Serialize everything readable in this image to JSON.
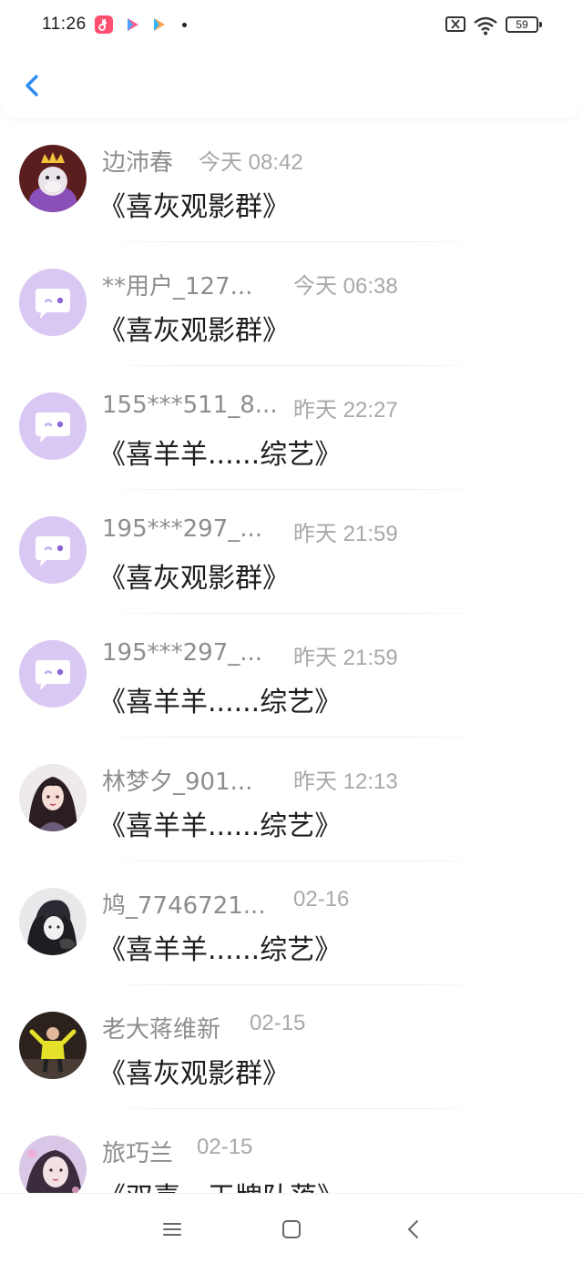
{
  "status_bar": {
    "time": "11:26",
    "battery": "59",
    "app_icons": [
      "douyin-icon",
      "play-icon",
      "play-icon"
    ]
  },
  "header": {
    "back_icon": "chevron-left-icon",
    "accent_color": "#2a8cf0"
  },
  "messages": [
    {
      "name": "边沛春",
      "time": "今天 08:42",
      "message": "《喜灰观影群》",
      "avatar": "cartoon-king-avatar"
    },
    {
      "name": "**用户_127...",
      "time": "今天 06:38",
      "message": "《喜灰观影群》",
      "avatar": "default-chat-avatar"
    },
    {
      "name": "155***511_8...",
      "time": "昨天 22:27",
      "message": "《喜羊羊......综艺》",
      "avatar": "default-chat-avatar"
    },
    {
      "name": "195***297_...",
      "time": "昨天 21:59",
      "message": "《喜灰观影群》",
      "avatar": "default-chat-avatar"
    },
    {
      "name": "195***297_...",
      "time": "昨天 21:59",
      "message": "《喜羊羊......综艺》",
      "avatar": "default-chat-avatar"
    },
    {
      "name": "林梦夕_901...",
      "time": "昨天 12:13",
      "message": "《喜羊羊......综艺》",
      "avatar": "anime-girl-avatar"
    },
    {
      "name": "鸠_7746721...",
      "time": "02-16",
      "message": "《喜羊羊......综艺》",
      "avatar": "anime-boy-avatar"
    },
    {
      "name": "老大蒋维新",
      "time": "02-15",
      "message": "《喜灰观影群》",
      "avatar": "photo-avatar"
    },
    {
      "name": "旅巧兰",
      "time": "02-15",
      "message": "《双喜・王牌队落》",
      "avatar": "photo-girl-avatar"
    }
  ],
  "nav_bar": {
    "icons": [
      "menu-icon",
      "home-square-icon",
      "back-triangle-icon"
    ]
  }
}
